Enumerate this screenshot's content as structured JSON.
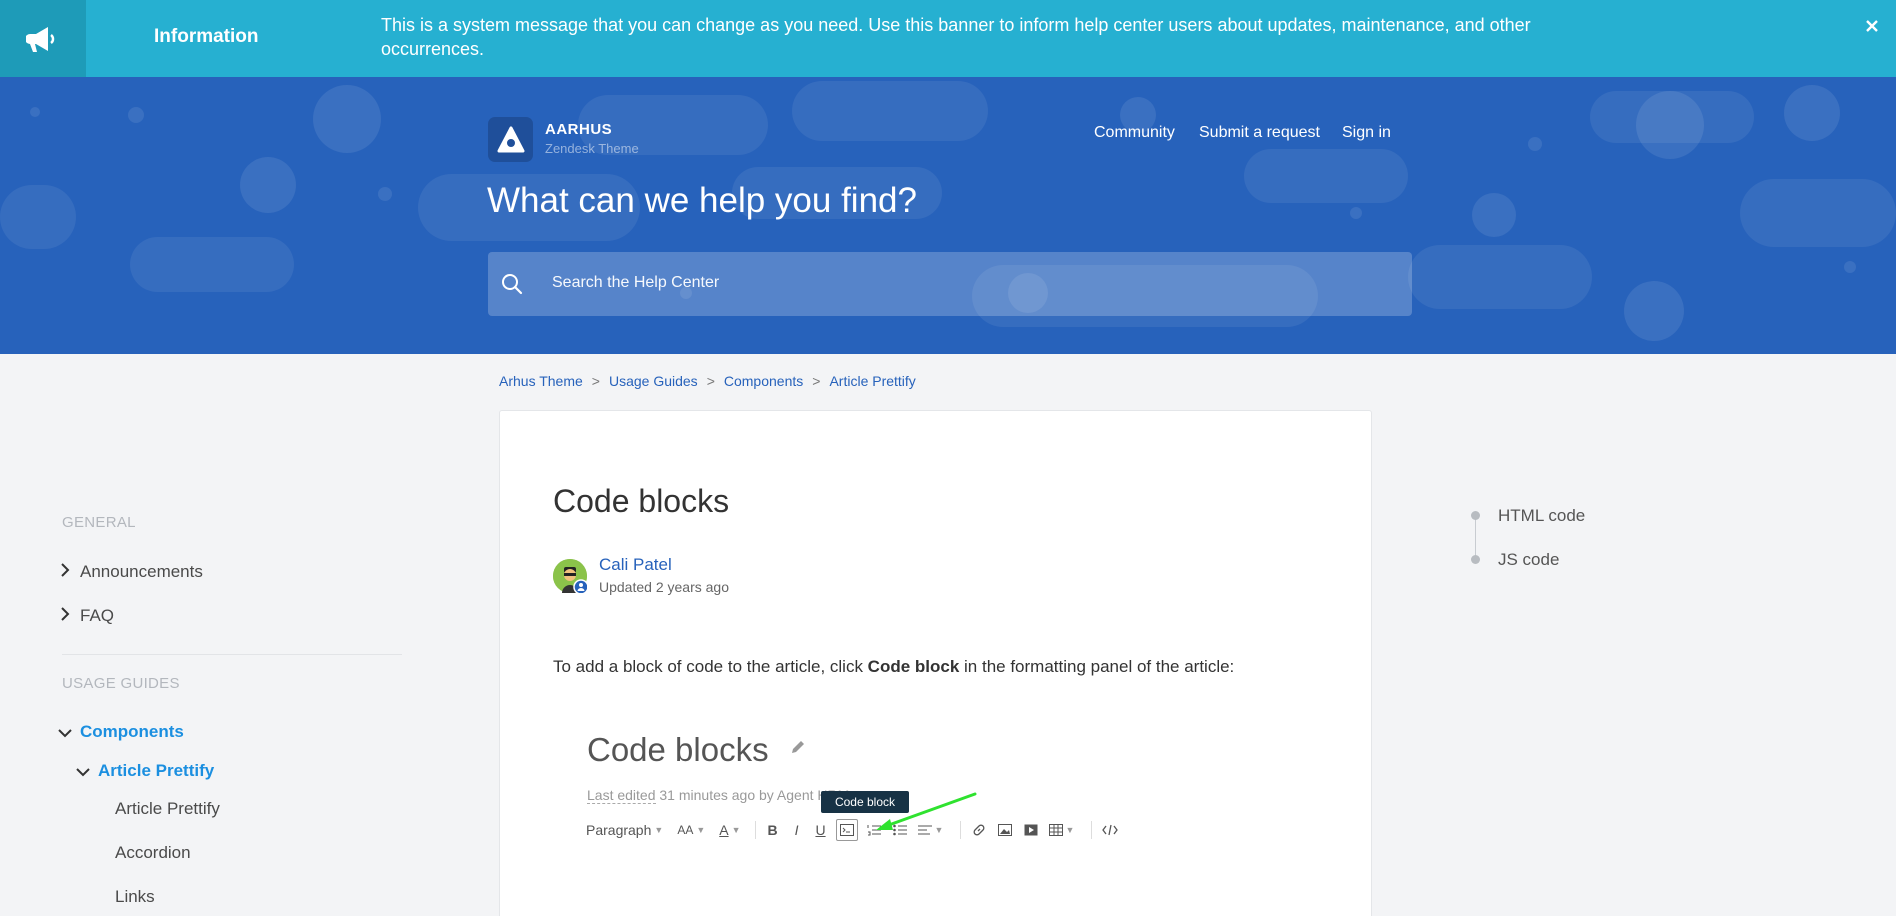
{
  "banner": {
    "label": "Information",
    "message": "This is a system message that you can change as you need. Use this banner to inform help center users about updates, maintenance, and other occurrences."
  },
  "header": {
    "logo_title": "AARHUS",
    "logo_subtitle": "Zendesk Theme",
    "nav": [
      "Community",
      "Submit a request",
      "Sign in"
    ],
    "hero_title": "What can we help you find?",
    "search_placeholder": "Search the Help Center"
  },
  "breadcrumb": [
    "Arhus Theme",
    "Usage Guides",
    "Components",
    "Article Prettify"
  ],
  "sidebar": {
    "general_heading": "General",
    "general_items": [
      "Announcements",
      "FAQ"
    ],
    "guides_heading": "Usage Guides",
    "components_label": "Components",
    "prettify_label": "Article Prettify",
    "sub_items": [
      "Article Prettify",
      "Accordion",
      "Links"
    ]
  },
  "article": {
    "title": "Code blocks",
    "author": "Cali Patel",
    "updated": "Updated 2 years ago",
    "intro_before": "To add a block of code to the article, click ",
    "intro_bold": "Code block",
    "intro_after": " in the formatting panel of the article:"
  },
  "embedded": {
    "title": "Code blocks",
    "meta_edited": "Last edited",
    "meta_rest": " 31 minutes ago by Agent HRM",
    "tooltip": "Code block",
    "paragraph": "Paragraph",
    "font_size": "AA",
    "font_color": "A",
    "bold": "B",
    "italic": "I",
    "underline": "U"
  },
  "toc": [
    "HTML code",
    "JS code"
  ],
  "colors": {
    "banner": "#26b0d1",
    "hero": "#2762bb",
    "link": "#2762bb",
    "active": "#1b8fe0",
    "arrow": "#2fe22f"
  }
}
